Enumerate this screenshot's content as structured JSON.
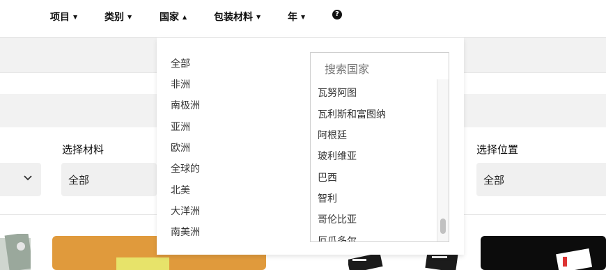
{
  "nav": {
    "items": [
      {
        "label": "项目",
        "caret": "▼"
      },
      {
        "label": "类别",
        "caret": "▼"
      },
      {
        "label": "国家",
        "caret": "▲"
      },
      {
        "label": "包装材料",
        "caret": "▼"
      },
      {
        "label": "年",
        "caret": "▼"
      }
    ],
    "help_icon": "question-circle-icon",
    "help_glyph": "?"
  },
  "filters": {
    "material_label": "选择材料",
    "material_value": "全部",
    "position_label": "选择位置",
    "position_value": "全部"
  },
  "dropdown": {
    "continents": [
      "全部",
      "非洲",
      "南极洲",
      "亚洲",
      "欧洲",
      "全球的",
      "北美",
      "大洋洲",
      "南美洲"
    ],
    "search_placeholder": "搜索国家",
    "countries": [
      "瓦努阿图",
      "瓦利斯和富图纳",
      "阿根廷",
      "玻利维亚",
      "巴西",
      "智利",
      "哥伦比亚",
      "厄瓜多尔"
    ]
  },
  "colors": {
    "accent_orange": "#e09a3c",
    "panel_bg": "#f2f2f2",
    "nav_text": "#111111"
  }
}
